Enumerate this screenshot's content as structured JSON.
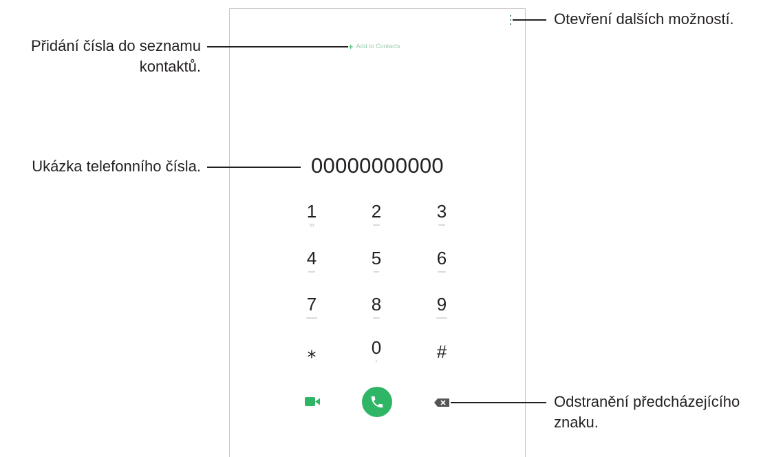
{
  "dialer": {
    "add_to_contacts_label": "Add to Contacts",
    "phone_number": "00000000000",
    "keys": [
      {
        "digit": "1",
        "sub": "ꝏ"
      },
      {
        "digit": "2",
        "sub": "ABC"
      },
      {
        "digit": "3",
        "sub": "DEF"
      },
      {
        "digit": "4",
        "sub": "GHI"
      },
      {
        "digit": "5",
        "sub": "JKL"
      },
      {
        "digit": "6",
        "sub": "MNO"
      },
      {
        "digit": "7",
        "sub": "PQRS"
      },
      {
        "digit": "8",
        "sub": "TUV"
      },
      {
        "digit": "9",
        "sub": "WXYZ"
      },
      {
        "digit": "⁎",
        "sub": ""
      },
      {
        "digit": "0",
        "sub": "+"
      },
      {
        "digit": "#",
        "sub": ""
      }
    ],
    "icons": {
      "menu": "more-options-icon",
      "video": "video-call-icon",
      "call": "phone-call-icon",
      "backspace": "backspace-icon"
    },
    "colors": {
      "accent": "#2fb566"
    }
  },
  "callouts": {
    "add_contact": "Přidání čísla do seznamu kontaktů.",
    "add_contact_line1": "Přidání čísla do seznamu",
    "add_contact_line2": "kontaktů.",
    "phone_number_preview": "Ukázka telefonního čísla.",
    "more_options": "Otevření dalších možností.",
    "delete_char_line1": "Odstranění předcházejícího",
    "delete_char_line2": "znaku."
  }
}
